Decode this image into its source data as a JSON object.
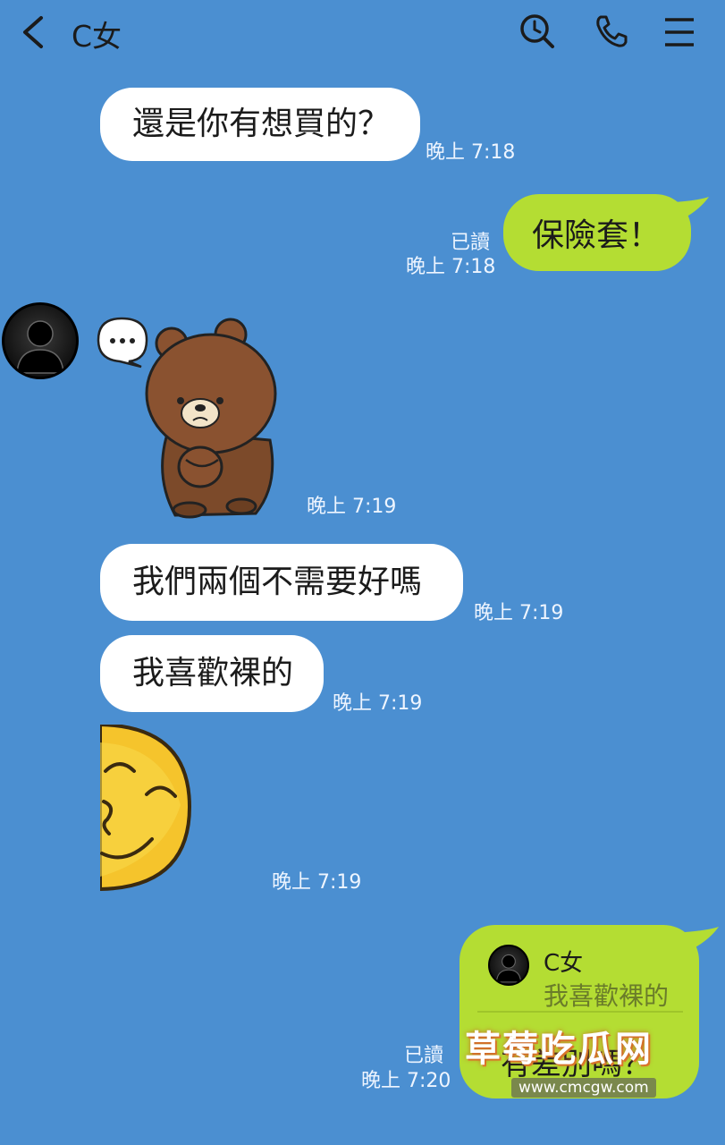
{
  "header": {
    "title": "C女",
    "icons": [
      "chevron-left-icon",
      "search-icon",
      "phone-icon",
      "menu-icon"
    ]
  },
  "messages": [
    {
      "side": "in",
      "text": "還是你有想買的？",
      "time": "晚上 7:18"
    },
    {
      "side": "out",
      "text": "保險套！",
      "read": "已讀",
      "time": "晚上 7:18"
    },
    {
      "side": "in",
      "type": "sticker",
      "sticker": "brown-bear-thinking-sticker",
      "time": "晚上 7:19"
    },
    {
      "side": "in",
      "text": "我們兩個不需要好嗎",
      "time": "晚上 7:19"
    },
    {
      "side": "in",
      "text": "我喜歡裸的",
      "time": "晚上 7:19"
    },
    {
      "side": "in",
      "type": "sticker",
      "sticker": "smirking-face-sticker",
      "time": "晚上 7:19"
    },
    {
      "side": "out",
      "type": "reply",
      "quote_author": "C女",
      "quote_text": "我喜歡裸的",
      "text": "有差別嗎？",
      "read": "已讀",
      "time": "晚上 7:20"
    }
  ],
  "watermark": {
    "text": "草莓吃瓜网",
    "url": "www.cmcgw.com"
  },
  "colors": {
    "background": "#4b8fd1",
    "incoming_bubble": "#ffffff",
    "outgoing_bubble": "#b4dd33"
  }
}
